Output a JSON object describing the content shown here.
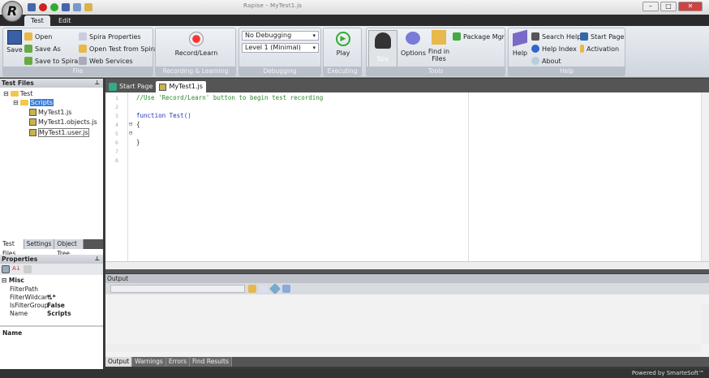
{
  "titlebar": {
    "title": "Rapise - MyTest1.js"
  },
  "ribbon_tabs": [
    "Test",
    "Edit"
  ],
  "groups": {
    "file": {
      "label": "File",
      "save": "Save",
      "open": "Open",
      "save_as": "Save As",
      "save_to_spira": "Save to Spira",
      "spira_properties": "Spira Properties",
      "open_from_spira": "Open Test from Spira",
      "web_services": "Web Services"
    },
    "recording": {
      "label": "Recording & Learning",
      "record": "Record/Learn"
    },
    "debugging": {
      "label": "Debugging",
      "debug_mode": "No Debugging",
      "level": "Level 1 (Minimal)"
    },
    "executing": {
      "label": "Executing",
      "play": "Play"
    },
    "tools": {
      "label": "Tools",
      "spy": "Spy",
      "options": "Options",
      "find_in_files": "Find in Files",
      "package_mgr": "Package Mgr"
    },
    "help": {
      "label": "Help",
      "help": "Help",
      "search_help": "Search Help",
      "help_index": "Help Index",
      "about": "About",
      "start_page": "Start Page",
      "activation": "Activation"
    }
  },
  "test_files": {
    "title": "Test Files",
    "root": "Test",
    "folder": "Scripts",
    "files": [
      "MyTest1.js",
      "MyTest1.objects.js",
      "MyTest1.user.js"
    ],
    "tabs": [
      "Test Files",
      "Settings",
      "Object Tree"
    ]
  },
  "properties": {
    "title": "Properties",
    "category": "Misc",
    "rows": [
      {
        "name": "FilterPath",
        "value": ""
      },
      {
        "name": "FilterWildcard",
        "value": "*.*"
      },
      {
        "name": "IsFilterGroup",
        "value": "False"
      },
      {
        "name": "Name",
        "value": "Scripts"
      }
    ],
    "desc_title": "Name"
  },
  "editor": {
    "tabs": [
      "Start Page",
      "MyTest1.js"
    ],
    "lines": [
      "1",
      "2",
      "3",
      "4",
      "5",
      "6",
      "7",
      "8"
    ],
    "comment": "//Use 'Record/Learn' button to begin test recording",
    "kw": "function",
    "fn": "Test()",
    "open": "{",
    "close": "}"
  },
  "output": {
    "title": "Output",
    "tabs": [
      "Output",
      "Warnings",
      "Errors",
      "Find Results"
    ]
  },
  "status": {
    "text": "Powered by SmarteSoft™"
  }
}
